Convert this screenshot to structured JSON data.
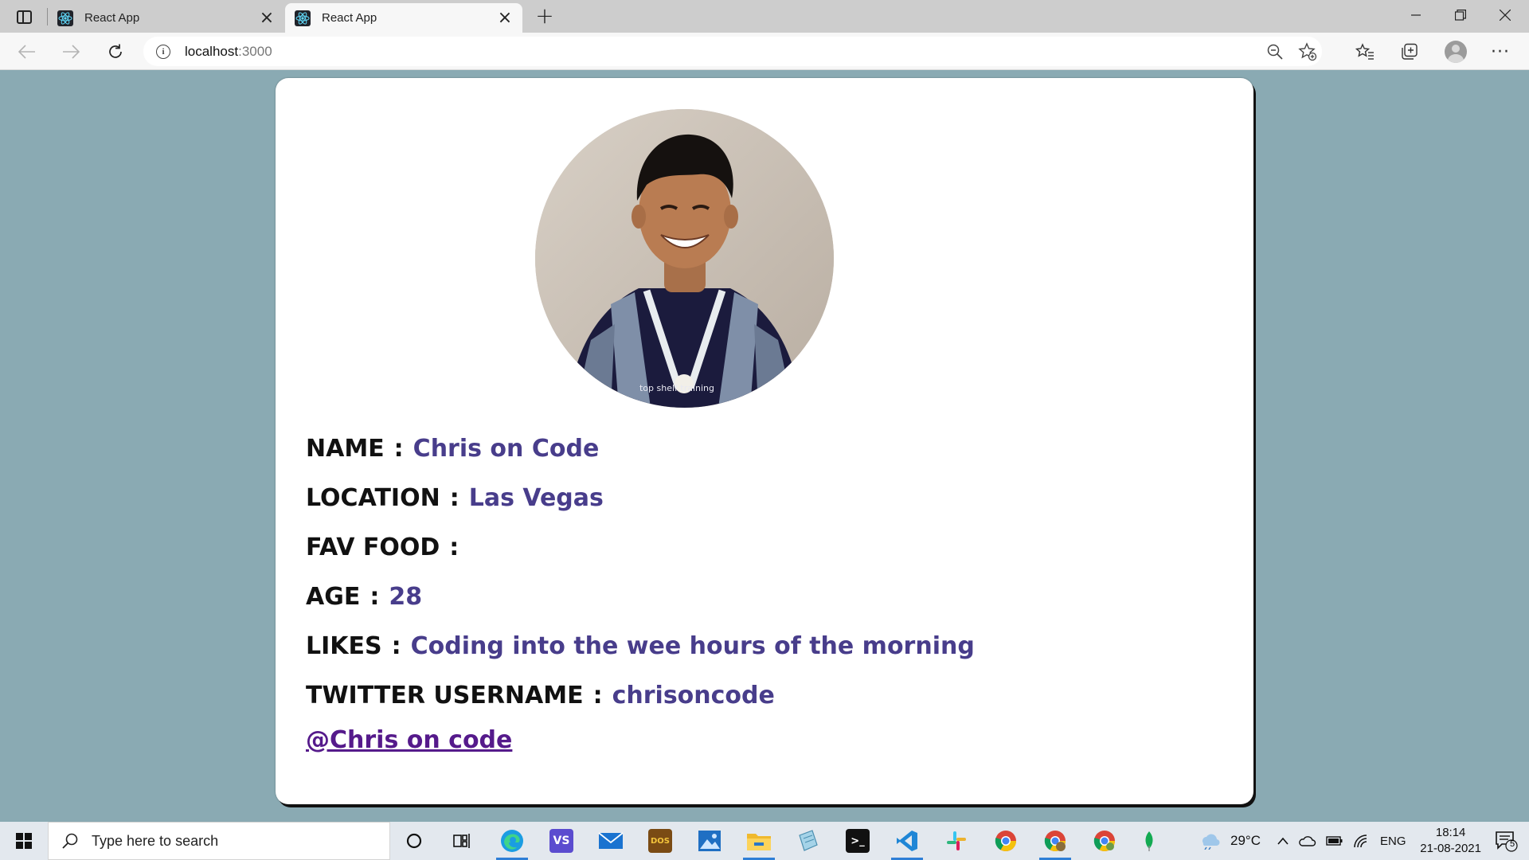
{
  "browser": {
    "tabs": [
      {
        "title": "React App",
        "active": false
      },
      {
        "title": "React App",
        "active": true
      }
    ],
    "address": {
      "host": "localhost",
      "port": ":3000"
    }
  },
  "profile": {
    "photo_alt": "profile photo",
    "name_label": "NAME",
    "name_value": "Chris on Code",
    "location_label": "LOCATION",
    "location_value": "Las Vegas",
    "food_label": "FAV FOOD",
    "food_value": "",
    "age_label": "AGE",
    "age_value": "28",
    "likes_label": "LIKES",
    "likes_value": "Coding into the wee hours of the morning",
    "twitter_label": "TWITTER USERNAME",
    "twitter_value": "chrisoncode",
    "link_text": "@Chris on code",
    "colon": ":",
    "photo_shirt_text": "top shelf training"
  },
  "taskbar": {
    "search_placeholder": "Type here to search",
    "weather": "29°C",
    "language": "ENG",
    "time": "18:14",
    "date": "21-08-2021",
    "notification_count": "5",
    "apps": [
      "cortana",
      "task-view",
      "edge",
      "visual-studio",
      "mail",
      "dosbox",
      "photos",
      "file-explorer",
      "notepad",
      "terminal",
      "vscode",
      "slack",
      "chrome",
      "chrome-profile",
      "chrome-2",
      "mongodb"
    ]
  },
  "colors": {
    "page_bg": "#8aaab3",
    "value_text": "#483d8b",
    "link": "#551a8b",
    "taskbar_accent": "#2f7fd6"
  }
}
